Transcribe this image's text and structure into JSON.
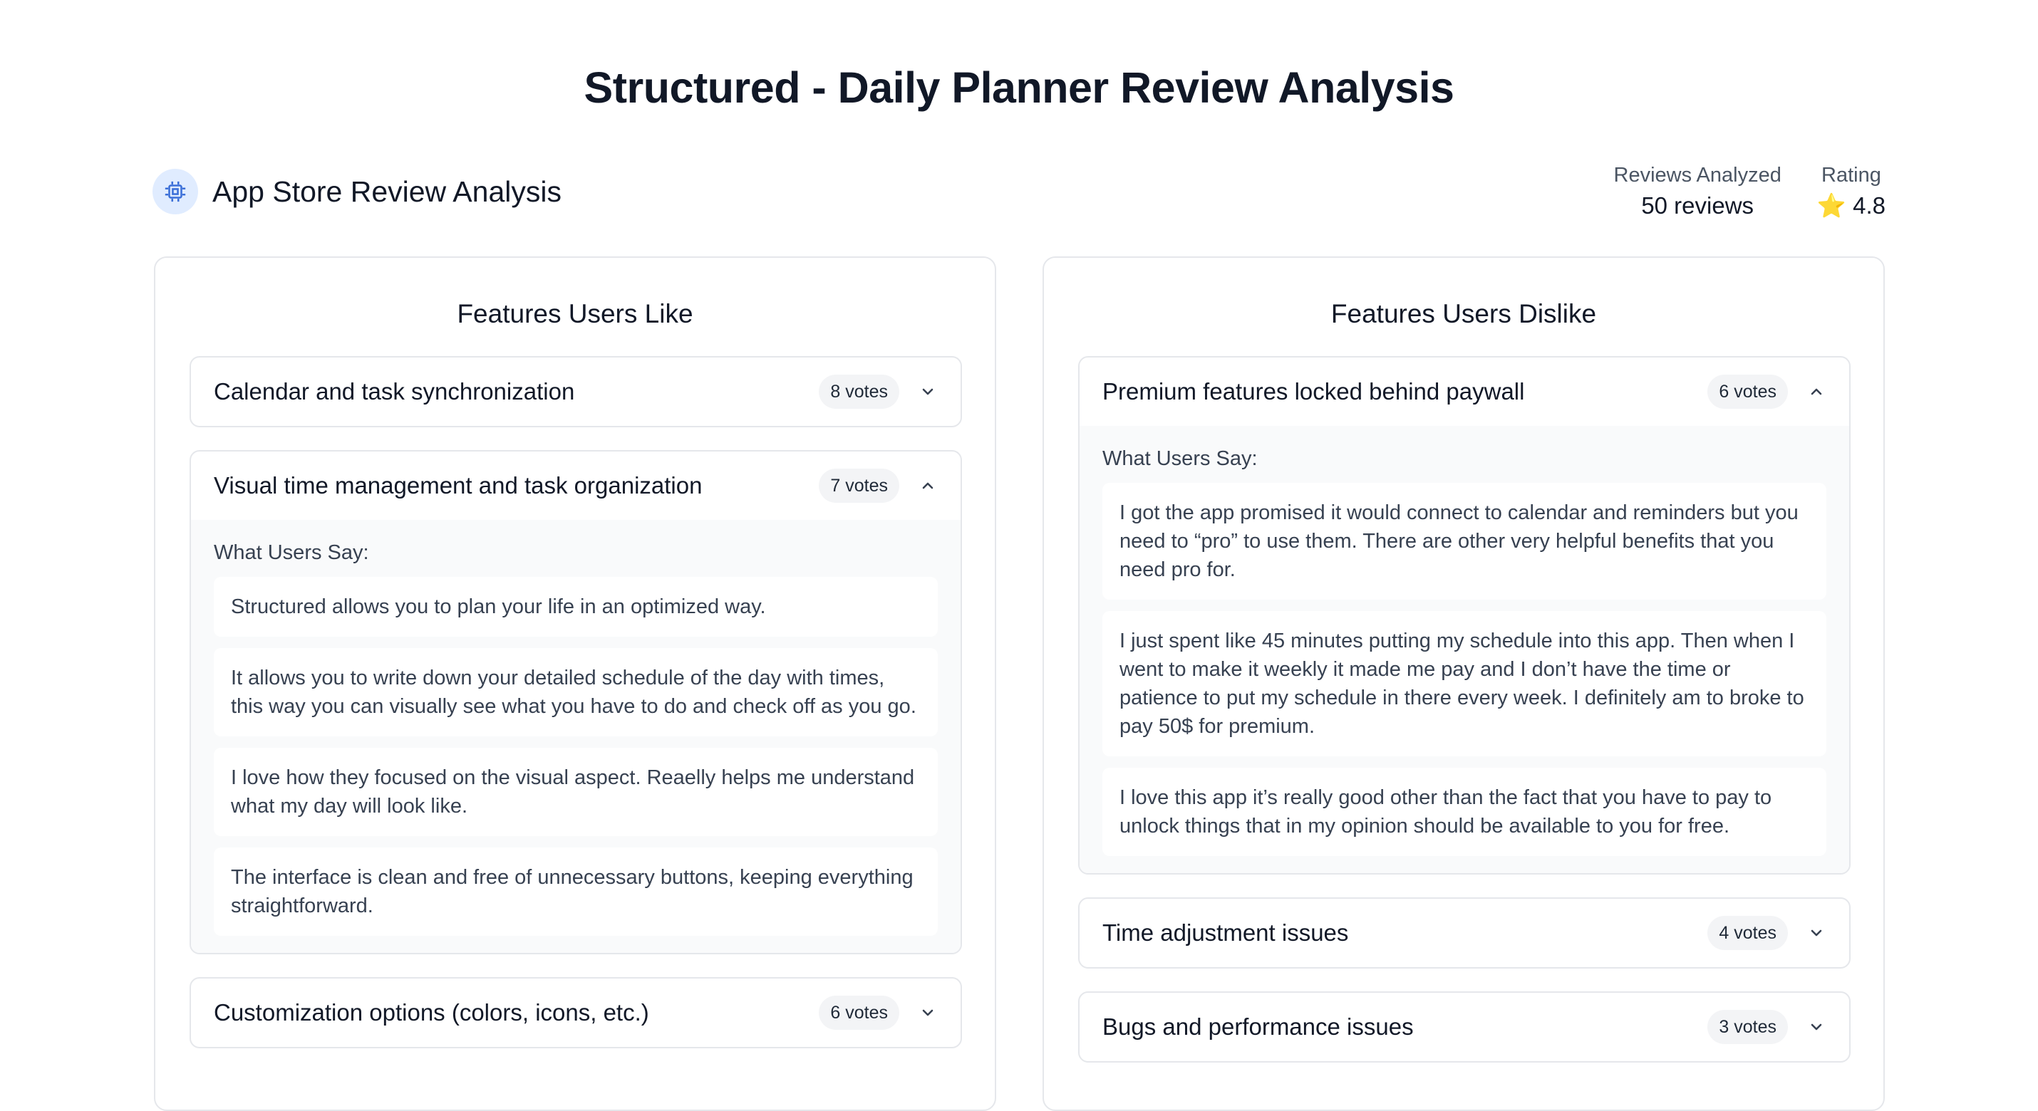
{
  "page": {
    "title": "Structured - Daily Planner Review Analysis"
  },
  "header": {
    "brand_title": "App Store Review Analysis",
    "brand_icon": "cpu-chip-icon",
    "stats": {
      "reviews_label": "Reviews Analyzed",
      "reviews_value": "50 reviews",
      "rating_label": "Rating",
      "rating_value": "⭐ 4.8"
    }
  },
  "likes": {
    "title": "Features Users Like",
    "items": [
      {
        "title": "Calendar and task synchronization",
        "votes": "8 votes",
        "expanded": false,
        "quotes": []
      },
      {
        "title": "Visual time management and task organization",
        "votes": "7 votes",
        "expanded": true,
        "say_label": "What Users Say:",
        "quotes": [
          "Structured allows you to plan your life in an optimized way.",
          "It allows you to write down your detailed schedule of the day with times, this way you can visually see what you have to do and check off as you go.",
          "I love how they focused on the visual aspect. Reaelly helps me understand what my day will look like.",
          "The interface is clean and free of unnecessary buttons, keeping everything straightforward."
        ]
      },
      {
        "title": "Customization options (colors, icons, etc.)",
        "votes": "6 votes",
        "expanded": false,
        "quotes": []
      }
    ]
  },
  "dislikes": {
    "title": "Features Users Dislike",
    "items": [
      {
        "title": "Premium features locked behind paywall",
        "votes": "6 votes",
        "expanded": true,
        "say_label": "What Users Say:",
        "quotes": [
          "I got the app promised it would connect to calendar and reminders but you need to “pro” to use them. There are other very helpful benefits that you need pro for.",
          "I just spent like 45 minutes putting my schedule into this app. Then when I went to make it weekly it made me pay and I don’t have the time or patience to put my schedule in there every week. I definitely am to broke to pay 50$ for premium.",
          "I love this app it’s really good other than the fact that you have to pay to unlock things that in my opinion should be available to you for free."
        ]
      },
      {
        "title": "Time adjustment issues",
        "votes": "4 votes",
        "expanded": false,
        "quotes": []
      },
      {
        "title": "Bugs and performance issues",
        "votes": "3 votes",
        "expanded": false,
        "quotes": []
      }
    ]
  }
}
